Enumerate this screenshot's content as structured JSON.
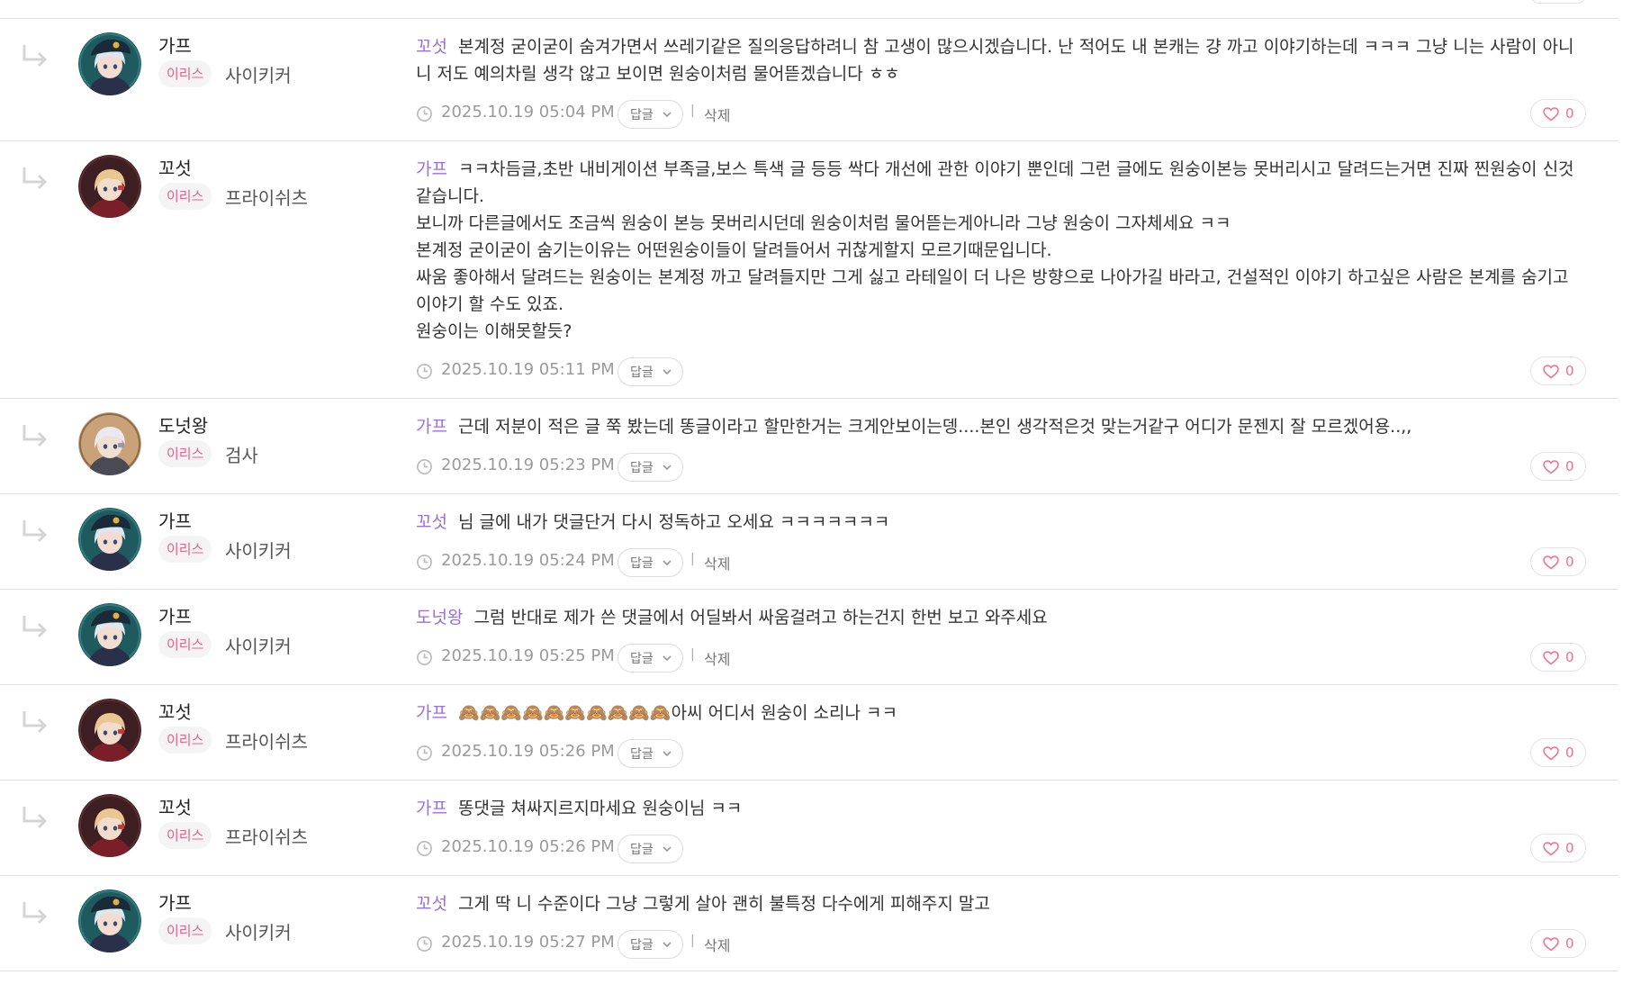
{
  "colors": {
    "mention": "#9a6fe0",
    "server_badge": "#e3628a",
    "like": "#f06f8f",
    "divider": "#e2e2e2"
  },
  "icons": {
    "reply": "reply-arrow-icon",
    "clock": "clock-icon",
    "like": "heart-icon",
    "reply_toggle": "chevron-down-icon"
  },
  "labels": {
    "reply": "답글",
    "delete": "삭제",
    "separator": "|"
  },
  "comments": [
    {
      "nickname": "가프",
      "server": "이리스",
      "job": "사이키커",
      "avatar": "silver-hair-officer",
      "mention": "꼬섯",
      "lines": [
        "본계정 굳이굳이 숨겨가면서 쓰레기같은 질의응답하려니 참 고생이 많으시겠습니다. 난 적어도 내 본캐는 걍 까고 이야기하는데 ㅋㅋㅋ 그냥 니는 사람이 아니니 저도 예의차릴 생각 않고 보이면 원숭이처럼 물어뜯겠습니다 ㅎㅎ"
      ],
      "date": "2025.10.19 05:04 PM",
      "deletable": true,
      "likes": "0"
    },
    {
      "nickname": "꼬섯",
      "server": "이리스",
      "job": "프라이쉬츠",
      "avatar": "blonde-eyepatch",
      "mention": "가프",
      "lines": [
        "ㅋㅋ차듬글,초반 내비게이션 부족글,보스 특색 글 등등 싹다 개선에 관한 이야기 뿐인데 그런 글에도 원숭이본능 못버리시고 달려드는거면 진짜 찐원숭이 신것같습니다.",
        "보니까 다른글에서도 조금씩 원숭이 본능 못버리시던데 원숭이처럼 물어뜯는게아니라 그냥 원숭이 그자체세요 ㅋㅋ",
        "본계정 굳이굳이 숨기는이유는 어떤원숭이들이 달려들어서 귀찮게할지 모르기때문입니다.",
        "싸움 좋아해서 달려드는 원숭이는 본계정 까고 달려들지만 그게 싫고 라테일이 더 나은 방향으로 나아가길 바라고, 건설적인 이야기 하고싶은 사람은 본계를 숨기고 이야기 할 수도 있죠.",
        "원숭이는 이해못할듯?"
      ],
      "date": "2025.10.19 05:11 PM",
      "deletable": false,
      "likes": "0"
    },
    {
      "nickname": "도넛왕",
      "server": "이리스",
      "job": "검사",
      "avatar": "white-hair-swordsman",
      "mention": "가프",
      "lines": [
        "근데 저분이 적은 글 쭉 봤는데 똥글이라고 할만한거는 크게안보이는뎅....본인 생각적은것 맞는거같구 어디가 문젠지 잘 모르겠어용..,,"
      ],
      "date": "2025.10.19 05:23 PM",
      "deletable": false,
      "likes": "0"
    },
    {
      "nickname": "가프",
      "server": "이리스",
      "job": "사이키커",
      "avatar": "silver-hair-officer",
      "mention": "꼬섯",
      "lines": [
        "님 글에 내가 댓글단거 다시 정독하고 오세요 ㅋㅋㅋㅋㅋㅋㅋ"
      ],
      "date": "2025.10.19 05:24 PM",
      "deletable": true,
      "likes": "0"
    },
    {
      "nickname": "가프",
      "server": "이리스",
      "job": "사이키커",
      "avatar": "silver-hair-officer",
      "mention": "도넛왕",
      "lines": [
        "그럼 반대로 제가 쓴 댓글에서 어딜봐서 싸움걸려고 하는건지 한번 보고 와주세요"
      ],
      "date": "2025.10.19 05:25 PM",
      "deletable": true,
      "likes": "0"
    },
    {
      "nickname": "꼬섯",
      "server": "이리스",
      "job": "프라이쉬츠",
      "avatar": "blonde-eyepatch",
      "mention": "가프",
      "lines": [
        "🙈🙈🙈🙈🙈🙈🙈🙈🙈🙈아씨 어디서 원숭이 소리나 ㅋㅋ"
      ],
      "date": "2025.10.19 05:26 PM",
      "deletable": false,
      "likes": "0"
    },
    {
      "nickname": "꼬섯",
      "server": "이리스",
      "job": "프라이쉬츠",
      "avatar": "blonde-eyepatch",
      "mention": "가프",
      "lines": [
        "똥댓글 쳐싸지르지마세요 원숭이님 ㅋㅋ"
      ],
      "date": "2025.10.19 05:26 PM",
      "deletable": false,
      "likes": "0"
    },
    {
      "nickname": "가프",
      "server": "이리스",
      "job": "사이키커",
      "avatar": "silver-hair-officer",
      "mention": "꼬섯",
      "lines": [
        "그게 딱 니 수준이다 그냥 그렇게 살아 괜히 불특정 다수에게 피해주지 말고"
      ],
      "date": "2025.10.19 05:27 PM",
      "deletable": true,
      "likes": "0"
    }
  ]
}
